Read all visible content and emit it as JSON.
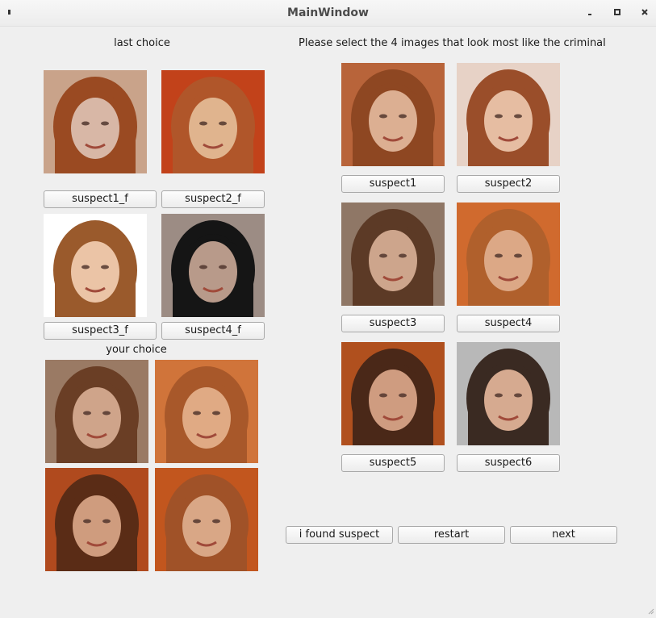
{
  "window": {
    "title": "MainWindow"
  },
  "left": {
    "last_choice_label": "last choice",
    "last_choice": [
      {
        "label": "suspect1_f",
        "hair": "#9a4a22",
        "bg": "#c9a38a",
        "skin": "#d8b7a6"
      },
      {
        "label": "suspect2_f",
        "hair": "#b0562a",
        "bg": "#c2421a",
        "skin": "#e0b48e"
      },
      {
        "label": "suspect3_f",
        "hair": "#9a5a2c",
        "bg": "#ffffff",
        "skin": "#ebc4a6"
      },
      {
        "label": "suspect4_f",
        "hair": "#151515",
        "bg": "#9c8c84",
        "skin": "#b89a8a"
      }
    ],
    "your_choice_label": "your choice",
    "your_choice": [
      {
        "hair": "#6a3e25",
        "bg": "#9a7a64",
        "skin": "#cfa48a"
      },
      {
        "hair": "#a8582a",
        "bg": "#d0743a",
        "skin": "#e0aa84"
      },
      {
        "hair": "#5a2c16",
        "bg": "#b04a1e",
        "skin": "#cf9c7e"
      },
      {
        "hair": "#a05228",
        "bg": "#c2561e",
        "skin": "#d9a786"
      }
    ]
  },
  "right": {
    "instruction": "Please select the 4  images that look most like the criminal",
    "suspects": [
      {
        "label": "suspect1",
        "hair": "#8e4722",
        "bg": "#b8643a",
        "skin": "#dcaf92"
      },
      {
        "label": "suspect2",
        "hair": "#9a4e2a",
        "bg": "#e7d2c6",
        "skin": "#e6bda2"
      },
      {
        "label": "suspect3",
        "hair": "#5c3a26",
        "bg": "#8f7766",
        "skin": "#cda58c"
      },
      {
        "label": "suspect4",
        "hair": "#b0602c",
        "bg": "#d06a2e",
        "skin": "#dca886"
      },
      {
        "label": "suspect5",
        "hair": "#4a2818",
        "bg": "#b0501e",
        "skin": "#cf9c80"
      },
      {
        "label": "suspect6",
        "hair": "#3a2a22",
        "bg": "#b8b8b8",
        "skin": "#d6aa90"
      }
    ]
  },
  "actions": {
    "found": "i found suspect",
    "restart": "restart",
    "next": "next"
  },
  "colors": {
    "window_bg": "#efefef",
    "titlebar": "#f2f2f2",
    "button_border": "#a9a9a9"
  }
}
